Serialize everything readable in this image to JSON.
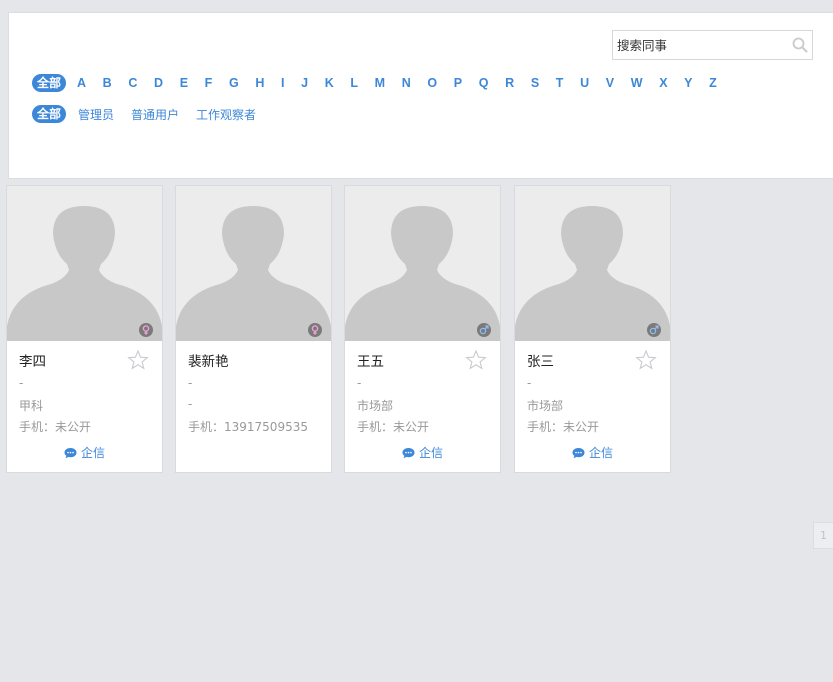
{
  "search": {
    "placeholder": "搜索同事"
  },
  "filters": {
    "all_label": "全部",
    "letters": [
      "A",
      "B",
      "C",
      "D",
      "E",
      "F",
      "G",
      "H",
      "I",
      "J",
      "K",
      "L",
      "M",
      "N",
      "O",
      "P",
      "Q",
      "R",
      "S",
      "T",
      "U",
      "V",
      "W",
      "X",
      "Y",
      "Z"
    ],
    "role_all_label": "全部",
    "roles": [
      "管理员",
      "普通用户",
      "工作观察者"
    ]
  },
  "cards": [
    {
      "name": "李四",
      "gender": "female",
      "line1": "-",
      "line2": "甲科",
      "phone": "手机：未公开",
      "chat_label": "企信"
    },
    {
      "name": "裴新艳",
      "gender": "female",
      "line1": "-",
      "line2": "-",
      "phone": "手机：13917509535",
      "chat_label": ""
    },
    {
      "name": "王五",
      "gender": "male",
      "line1": "-",
      "line2": "市场部",
      "phone": "手机：未公开",
      "chat_label": "企信"
    },
    {
      "name": "张三",
      "gender": "male",
      "line1": "-",
      "line2": "市场部",
      "phone": "手机：未公开",
      "chat_label": "企信"
    }
  ],
  "pagination": {
    "current_page": "1"
  },
  "colors": {
    "accent": "#3d87d8",
    "female_badge": "#d37ab8",
    "male_badge": "#4f86c6"
  }
}
